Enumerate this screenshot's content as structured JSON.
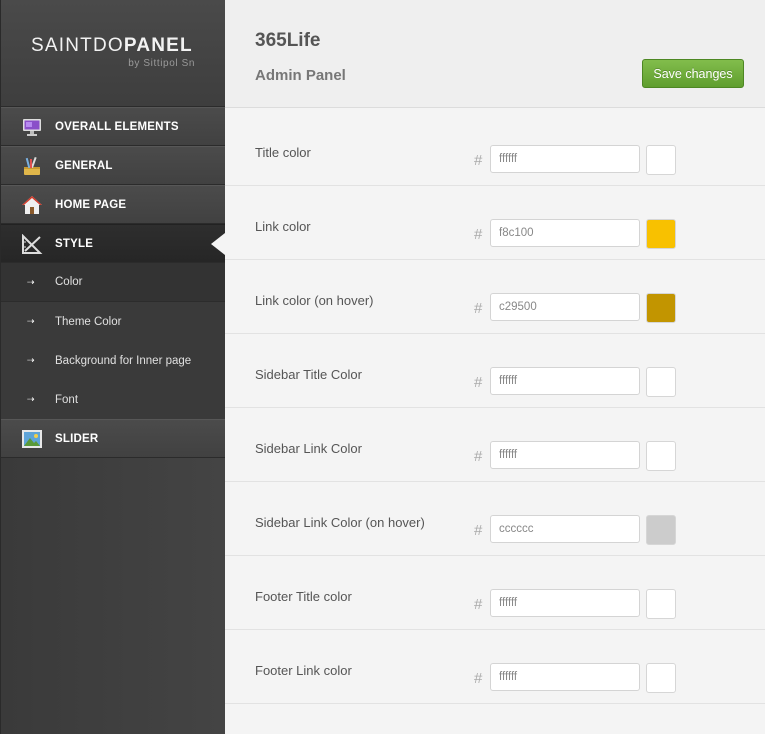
{
  "logo": {
    "title_light": "SAINTDO",
    "title_bold": "PANEL",
    "subtitle": "by Sittipol Sn"
  },
  "sidebar": {
    "items": [
      {
        "label": "OVERALL ELEMENTS",
        "icon": "monitor-icon"
      },
      {
        "label": "GENERAL",
        "icon": "tools-icon"
      },
      {
        "label": "HOME PAGE",
        "icon": "house-icon"
      },
      {
        "label": "STYLE",
        "icon": "ruler-icon",
        "active": true
      },
      {
        "label": "SLIDER",
        "icon": "picture-icon"
      }
    ],
    "style_subitems": [
      {
        "label": "Color",
        "active": true
      },
      {
        "label": "Theme Color"
      },
      {
        "label": "Background for Inner page"
      },
      {
        "label": "Font"
      }
    ]
  },
  "header": {
    "site_title": "365Life",
    "panel_subtitle": "Admin Panel",
    "save_label": "Save changes"
  },
  "colors": {
    "hash_symbol": "#",
    "fields": [
      {
        "label": "Title color",
        "value": "ffffff",
        "swatch": "#ffffff"
      },
      {
        "label": "Link color",
        "value": "f8c100",
        "swatch": "#f8c100"
      },
      {
        "label": "Link color (on hover)",
        "value": "c29500",
        "swatch": "#c29500"
      },
      {
        "label": "Sidebar Title Color",
        "value": "ffffff",
        "swatch": "#ffffff"
      },
      {
        "label": "Sidebar Link Color",
        "value": "ffffff",
        "swatch": "#ffffff"
      },
      {
        "label": "Sidebar Link Color (on hover)",
        "value": "cccccc",
        "swatch": "#cccccc"
      },
      {
        "label": "Footer Title color",
        "value": "ffffff",
        "swatch": "#ffffff"
      },
      {
        "label": "Footer Link color",
        "value": "ffffff",
        "swatch": "#ffffff"
      }
    ]
  }
}
